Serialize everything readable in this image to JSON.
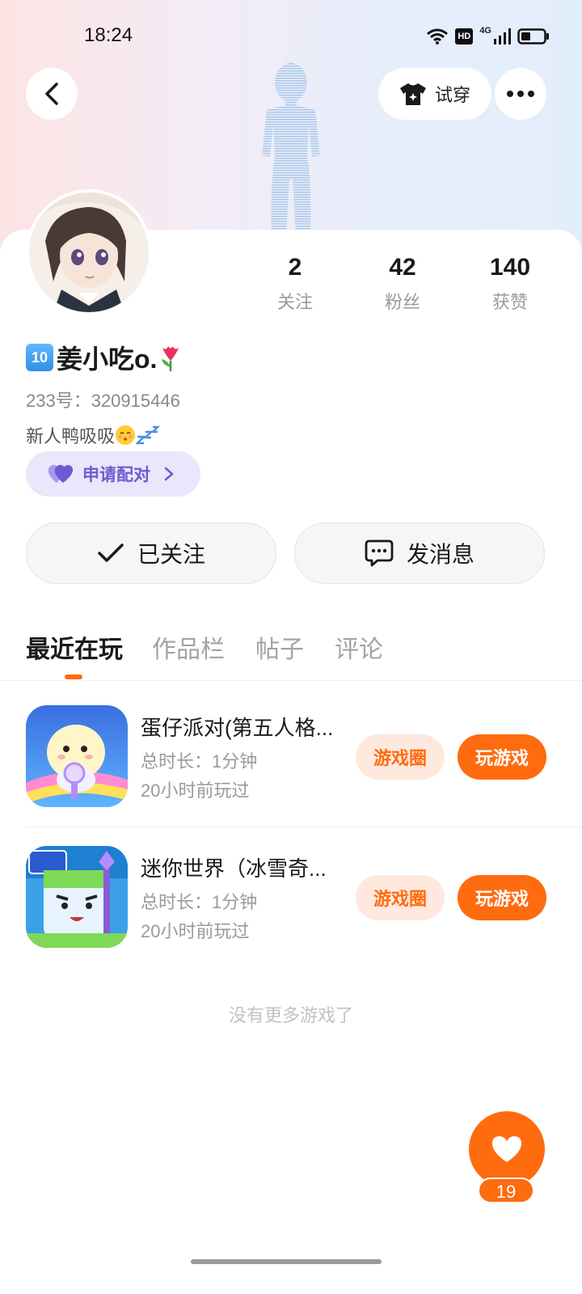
{
  "status_bar": {
    "time": "18:24",
    "hd_label": "HD",
    "network": "4G"
  },
  "header": {
    "try_on_label": "试穿"
  },
  "profile": {
    "name_badge": "10",
    "name": "姜小吃o.",
    "uid": "233号：320915446",
    "bio": "新人鸭吸吸",
    "pair_label": "申请配对"
  },
  "stats": [
    {
      "value": "2",
      "label": "关注"
    },
    {
      "value": "42",
      "label": "粉丝"
    },
    {
      "value": "140",
      "label": "获赞"
    }
  ],
  "actions": {
    "follow_label": "已关注",
    "message_label": "发消息"
  },
  "tabs": [
    "最近在玩",
    "作品栏",
    "帖子",
    "评论"
  ],
  "games": [
    {
      "title": "蛋仔派对(第五人格...",
      "duration": "总时长：1分钟",
      "last_played": "20小时前玩过",
      "circle_label": "游戏圈",
      "play_label": "玩游戏"
    },
    {
      "title": "迷你世界（冰雪奇...",
      "duration": "总时长：1分钟",
      "last_played": "20小时前玩过",
      "circle_label": "游戏圈",
      "play_label": "玩游戏"
    }
  ],
  "footer": {
    "no_more": "没有更多游戏了",
    "like_count": "19"
  },
  "colors": {
    "accent": "#ff6b0f",
    "accent_light": "#ffe9de",
    "pair_bg": "#eae6fb",
    "pair_text": "#6f5ad1"
  },
  "icons": [
    "back-icon",
    "shirt-icon",
    "more-icon",
    "heart-icon",
    "check-icon",
    "chat-icon",
    "chevron-right-icon",
    "wifi-icon",
    "signal-icon",
    "battery-icon"
  ]
}
